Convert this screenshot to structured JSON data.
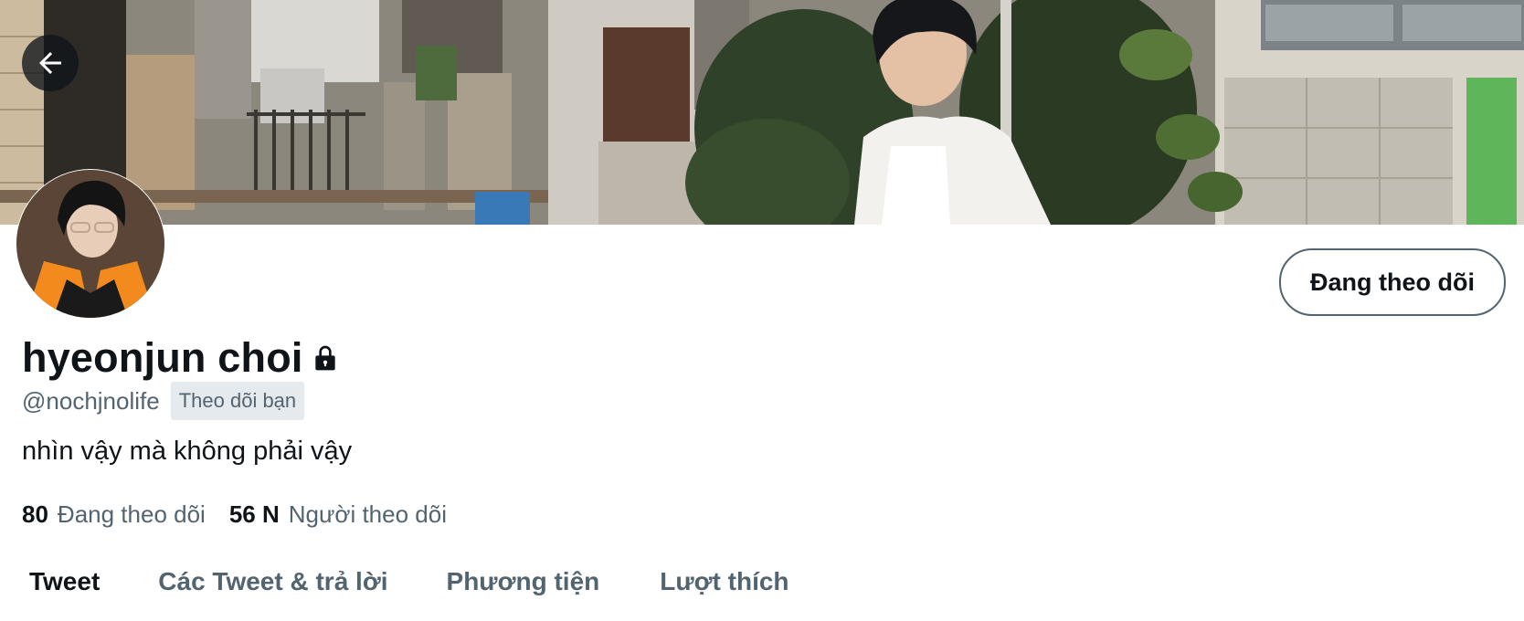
{
  "profile": {
    "display_name": "hyeonjun choi",
    "handle": "@nochjnolife",
    "follows_you_badge": "Theo dõi bạn",
    "bio": "nhìn vậy mà không phải vậy",
    "following_count": "80",
    "following_label": "Đang theo dõi",
    "followers_count": "56 N",
    "followers_label": "Người theo dõi",
    "protected": true
  },
  "actions": {
    "follow_button_label": "Đang theo dõi"
  },
  "tabs": [
    {
      "label": "Tweet",
      "active": true
    },
    {
      "label": "Các Tweet & trả lời",
      "active": false
    },
    {
      "label": "Phương tiện",
      "active": false
    },
    {
      "label": "Lượt thích",
      "active": false
    }
  ],
  "icons": {
    "back": "arrow-left-icon",
    "lock": "lock-icon"
  },
  "colors": {
    "text_primary": "#0f1419",
    "text_secondary": "#536471",
    "badge_background": "#e5eaee",
    "avatar_accent": "#f28a1e"
  }
}
